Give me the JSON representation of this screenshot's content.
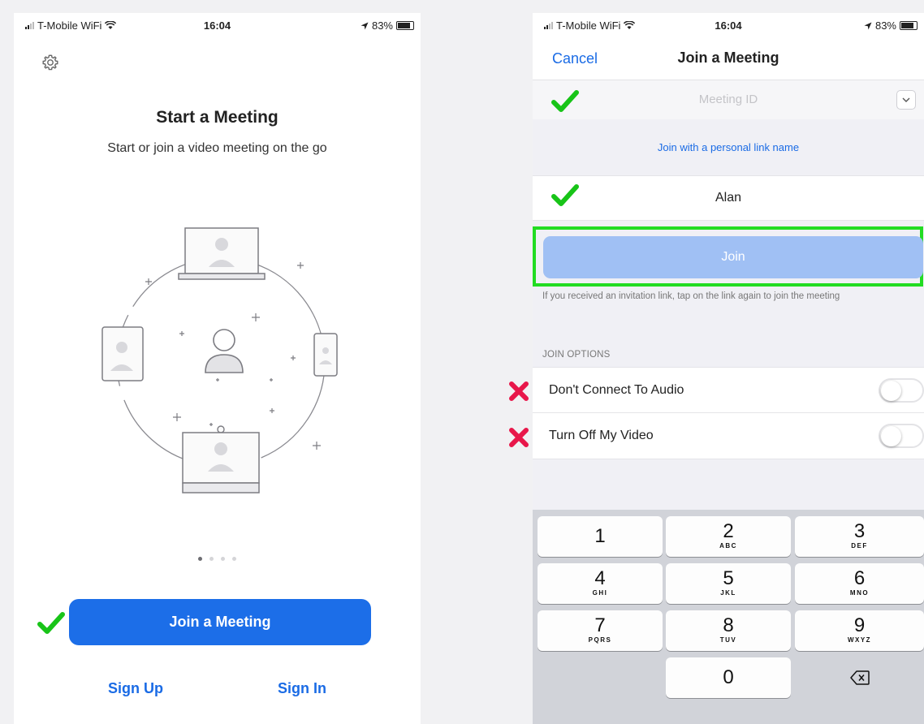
{
  "left": {
    "status": {
      "carrier": "T-Mobile WiFi",
      "time": "16:04",
      "battery": "83%"
    },
    "title": "Start a Meeting",
    "subtitle": "Start or join a video meeting on the go",
    "page_dots": {
      "count": 4,
      "active": 1
    },
    "join_meeting_label": "Join a Meeting",
    "sign_up_label": "Sign Up",
    "sign_in_label": "Sign In"
  },
  "right": {
    "status": {
      "carrier": "T-Mobile WiFi",
      "time": "16:04",
      "battery": "83%"
    },
    "nav": {
      "cancel_label": "Cancel",
      "title": "Join a Meeting"
    },
    "meeting_id_placeholder": "Meeting ID",
    "personal_link_label": "Join with a personal link name",
    "name_value": "Alan",
    "join_label": "Join",
    "invite_note": "If you received an invitation link, tap on the link again to join the meeting",
    "join_options_header": "JOIN OPTIONS",
    "options": [
      {
        "label": "Don't Connect To Audio",
        "on": false
      },
      {
        "label": "Turn Off My Video",
        "on": false
      }
    ],
    "keypad": [
      {
        "digit": "1",
        "letters": ""
      },
      {
        "digit": "2",
        "letters": "ABC"
      },
      {
        "digit": "3",
        "letters": "DEF"
      },
      {
        "digit": "4",
        "letters": "GHI"
      },
      {
        "digit": "5",
        "letters": "JKL"
      },
      {
        "digit": "6",
        "letters": "MNO"
      },
      {
        "digit": "7",
        "letters": "PQRS"
      },
      {
        "digit": "8",
        "letters": "TUV"
      },
      {
        "digit": "9",
        "letters": "WXYZ"
      },
      {
        "digit": "0",
        "letters": ""
      }
    ]
  },
  "annotation_colors": {
    "check": "#18c418",
    "cross": "#e8174a",
    "highlight": "#22dc22"
  }
}
